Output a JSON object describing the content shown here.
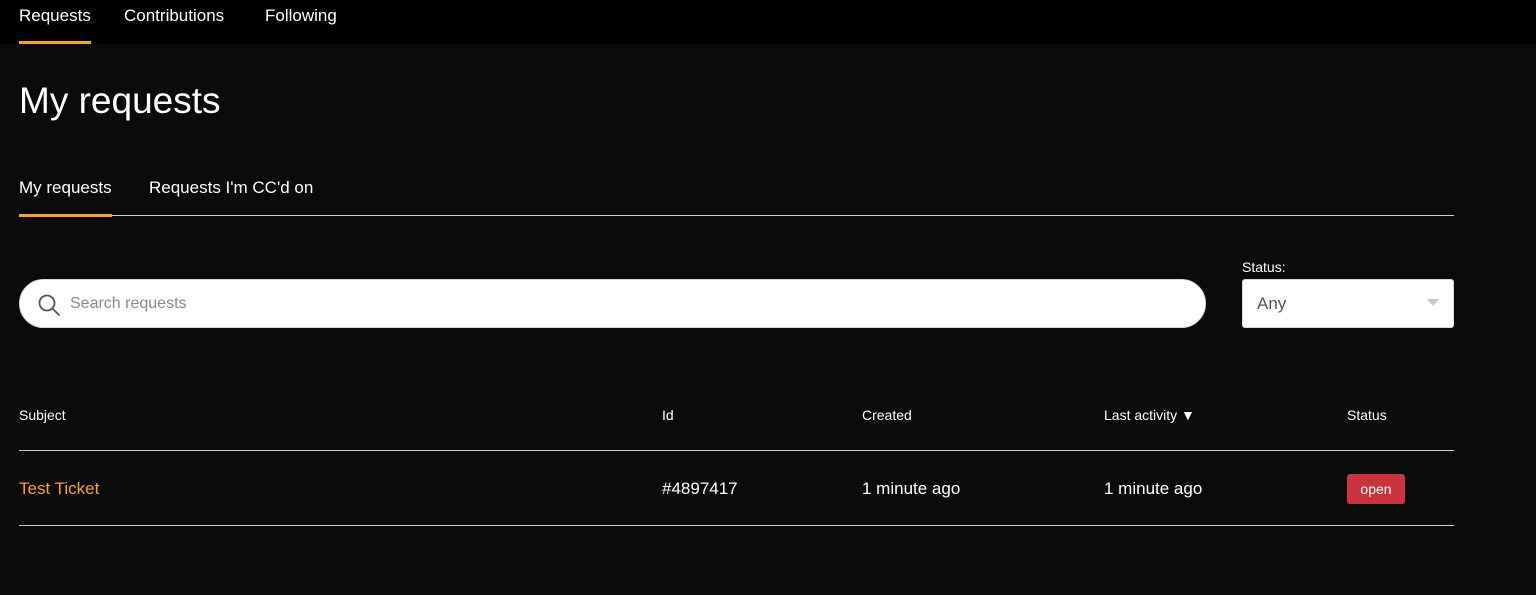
{
  "topnav": {
    "items": [
      {
        "label": "Requests",
        "active": true
      },
      {
        "label": "Contributions",
        "active": false
      },
      {
        "label": "Following",
        "active": false
      }
    ]
  },
  "page": {
    "title": "My requests"
  },
  "subtabs": {
    "items": [
      {
        "label": "My requests",
        "active": true
      },
      {
        "label": "Requests I'm CC'd on",
        "active": false
      }
    ]
  },
  "search": {
    "placeholder": "Search requests",
    "value": ""
  },
  "status_filter": {
    "label": "Status:",
    "selected": "Any"
  },
  "table": {
    "columns": {
      "subject": "Subject",
      "id": "Id",
      "created": "Created",
      "last_activity": "Last activity ▼",
      "status": "Status"
    },
    "rows": [
      {
        "subject": "Test Ticket",
        "id": "#4897417",
        "created": "1 minute ago",
        "last_activity": "1 minute ago",
        "status": "open"
      }
    ]
  },
  "colors": {
    "background": "#0a0a0a",
    "accent": "#f5a623",
    "status_open": "#cc3340"
  },
  "icons": {
    "search": "search-icon",
    "dropdown": "chevron-down-icon",
    "sort": "sort-desc-icon"
  }
}
